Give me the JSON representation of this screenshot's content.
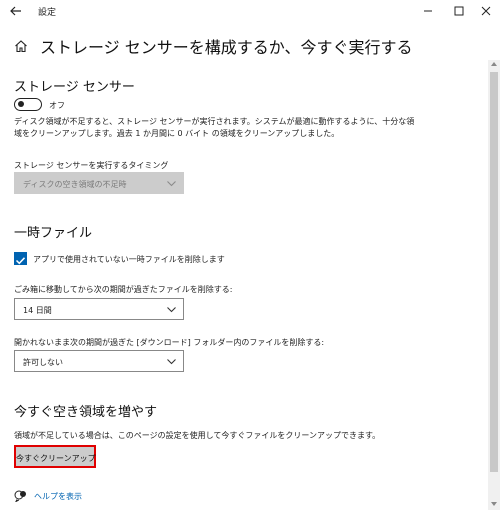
{
  "window": {
    "title": "設定"
  },
  "page": {
    "title": "ストレージ センサーを構成するか、今すぐ実行する"
  },
  "storage_sense": {
    "heading": "ストレージ センサー",
    "toggle_state": "オフ",
    "toggle_on": false,
    "description": "ディスク領域が不足すると、ストレージ センサーが実行されます。システムが最適に動作するように、十分な領域をクリーンアップします。過去 1 か月間に 0 バイト の領域をクリーンアップしました。",
    "timing_label": "ストレージ センサーを実行するタイミング",
    "timing_value": "ディスクの空き領域の不足時",
    "timing_disabled": true
  },
  "temp_files": {
    "heading": "一時ファイル",
    "delete_unused_label": "アプリで使用されていない一時ファイルを削除します",
    "delete_unused_checked": true,
    "recycle_label": "ごみ箱に移動してから次の期間が過ぎたファイルを削除する:",
    "recycle_value": "14 日間",
    "downloads_label": "開かれないまま次の期間が過ぎた [ダウンロード] フォルダー内のファイルを削除する:",
    "downloads_value": "許可しない"
  },
  "free_space": {
    "heading": "今すぐ空き領域を増やす",
    "description": "領域が不足している場合は、このページの設定を使用して今すぐファイルをクリーンアップできます。",
    "button_label": "今すぐクリーンアップ"
  },
  "help": {
    "link_label": "ヘルプを表示"
  },
  "colors": {
    "accent": "#0063b1",
    "button_bg": "#cccccc",
    "highlight_border": "#e00000"
  }
}
